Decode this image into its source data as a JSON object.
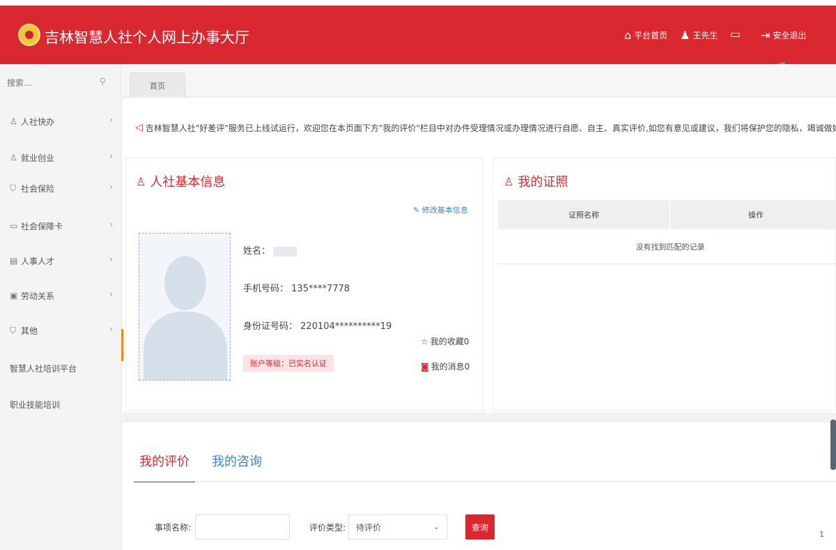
{
  "header": {
    "title": "吉林智慧人社个人网上办事大厅",
    "nav": [
      {
        "label": "平台首页",
        "icon": "home-icon"
      },
      {
        "label": "王先生",
        "icon": "user-icon"
      },
      {
        "label": "",
        "icon": "message-icon"
      },
      {
        "label": "安全退出",
        "icon": "logout-icon"
      }
    ]
  },
  "sidebar": {
    "search_placeholder": "搜索...",
    "items": [
      {
        "label": "人社快办",
        "icon": "person-icon",
        "arrow": "›"
      },
      {
        "label": "就业创业",
        "icon": "briefcase-icon",
        "arrow": "›"
      },
      {
        "label": "社会保险",
        "icon": "shield-icon",
        "arrow": "›"
      },
      {
        "label": "社会保障卡",
        "icon": "card-icon",
        "arrow": "›"
      },
      {
        "label": "人事人才",
        "icon": "document-icon",
        "arrow": "›"
      },
      {
        "label": "劳动关系",
        "icon": "contract-icon",
        "arrow": "›"
      },
      {
        "label": "其他",
        "icon": "badge-icon",
        "arrow": "›"
      },
      {
        "label": "智慧人社培训平台",
        "icon": "",
        "arrow": ""
      },
      {
        "label": "职业技能培训",
        "icon": "",
        "arrow": ""
      }
    ]
  },
  "tabs": {
    "home": "首页"
  },
  "notice": "吉林智慧人社\"好差评\"服务已上线试运行，欢迎您在本页面下方\"我的评价\"栏目中对办件受理情况或办理情况进行自愿、自主、真实评价,如您有意见或建议，我们将保护您的隐私，竭诚做好人社工作",
  "basic_info": {
    "title": "人社基本信息",
    "edit_label": "修改基本信息",
    "name_label": "姓名：",
    "phone_label": "手机号码：",
    "phone": "135****7778",
    "id_label": "身份证号码：",
    "id_number": "220104**********19",
    "status": "账户等级：已实名认证",
    "favorites_label": "我的收藏",
    "favorites_count": "0",
    "messages_label": "我的消息",
    "messages_count": "0"
  },
  "certificates": {
    "title": "我的证照",
    "col_name": "证照名称",
    "col_action": "操作",
    "empty": "没有找到匹配的记录"
  },
  "evaluation": {
    "tab_active": "我的评价",
    "tab_inactive": "我的咨询",
    "item_label": "事项名称:",
    "item_value": "",
    "type_label": "评价类型:",
    "type_value": "待评价",
    "query_label": "查询"
  },
  "scroll_number": "1",
  "colors": {
    "brand_red": "#d9282f",
    "link_blue": "#3c84c9",
    "accent_orange": "#f08a1a"
  }
}
